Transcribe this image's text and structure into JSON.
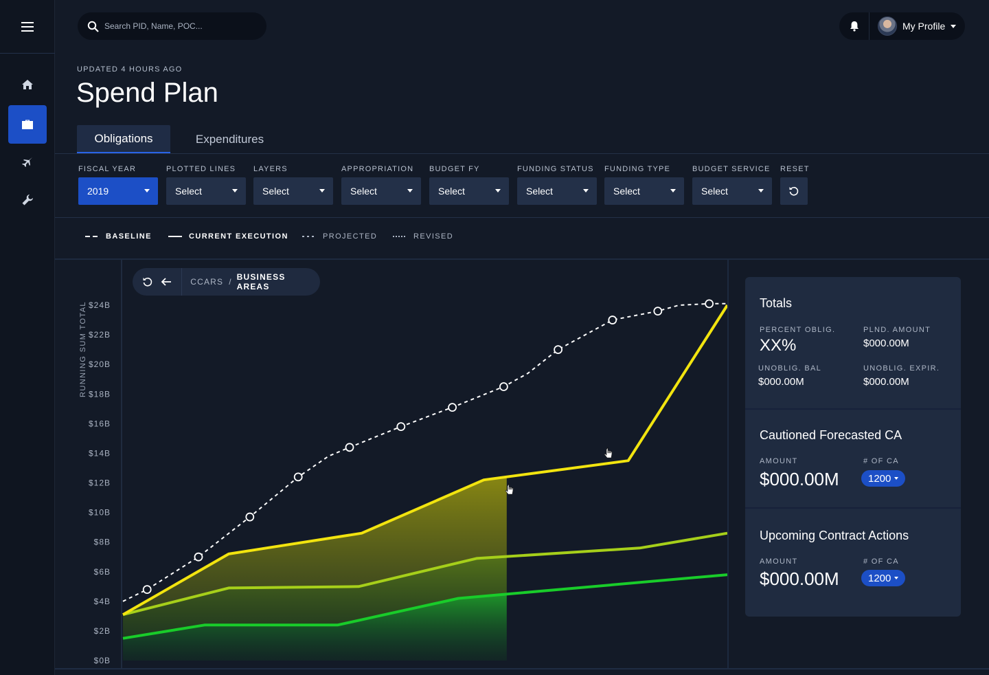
{
  "search": {
    "placeholder": "Search PID, Name, POC..."
  },
  "profile": {
    "name": "My Profile"
  },
  "header": {
    "updated": "UPDATED 4 HOURS AGO",
    "title": "Spend Plan"
  },
  "tabs": [
    {
      "label": "Obligations"
    },
    {
      "label": "Expenditures"
    }
  ],
  "filters": [
    {
      "label": "FISCAL YEAR",
      "value": "2019"
    },
    {
      "label": "PLOTTED LINES",
      "value": "Select"
    },
    {
      "label": "LAYERS",
      "value": "Select"
    },
    {
      "label": "APPROPRIATION",
      "value": "Select"
    },
    {
      "label": "BUDGET FY",
      "value": "Select"
    },
    {
      "label": "FUNDING STATUS",
      "value": "Select"
    },
    {
      "label": "FUNDING TYPE",
      "value": "Select"
    },
    {
      "label": "BUDGET SERVICE",
      "value": "Select"
    }
  ],
  "reset_label": "RESET",
  "legend": [
    {
      "label": "BASELINE"
    },
    {
      "label": "CURRENT EXECUTION"
    },
    {
      "label": "PROJECTED"
    },
    {
      "label": "REVISED"
    }
  ],
  "breadcrumb": {
    "parent": "CCARS",
    "sep": "/",
    "current": "BUSINESS AREAS"
  },
  "totals": {
    "title": "Totals",
    "percent_label": "PERCENT OBLIG.",
    "percent_value": "XX%",
    "plnd_label": "PLND. AMOUNT",
    "plnd_value": "$000.00M",
    "unoblig_label": "UNOBLIG. BAL",
    "unoblig_value": "$000.00M",
    "expir_label": "UNOBLIG. EXPIR.",
    "expir_value": "$000.00M"
  },
  "cautioned": {
    "title": "Cautioned Forecasted CA",
    "amount_label": "AMOUNT",
    "amount_value": "$000.00M",
    "count_label": "# OF CA",
    "count_value": "1200"
  },
  "upcoming": {
    "title": "Upcoming Contract Actions",
    "amount_label": "AMOUNT",
    "amount_value": "$000.00M",
    "count_label": "# OF CA",
    "count_value": "1200"
  },
  "colors": {
    "accent": "#1c4fc6",
    "execution": "#f2e40f",
    "mid_line": "#a6cf1a",
    "low_line": "#19cc2a",
    "background": "#131a27"
  },
  "chart_data": {
    "type": "line",
    "ylabel": "RUNNING SUM TOTAL",
    "ytick_labels": [
      "$24B",
      "$22B",
      "$20B",
      "$18B",
      "$16B",
      "$14B",
      "$12B",
      "$10B",
      "$8B",
      "$6B",
      "$4B",
      "$2B",
      "$0B"
    ],
    "ylim": [
      0,
      24
    ],
    "xlim": [
      0,
      1
    ],
    "grid": false,
    "series": [
      {
        "key": "projected",
        "style": "dashed-markers",
        "points": [
          [
            0,
            4
          ],
          [
            0.04,
            4.8
          ],
          [
            0.125,
            7
          ],
          [
            0.21,
            9.7
          ],
          [
            0.29,
            12.4
          ],
          [
            0.34,
            13.8
          ],
          [
            0.375,
            14.4
          ],
          [
            0.46,
            15.8
          ],
          [
            0.545,
            17.1
          ],
          [
            0.63,
            18.5
          ],
          [
            0.67,
            19.4
          ],
          [
            0.72,
            21
          ],
          [
            0.81,
            23
          ],
          [
            0.885,
            23.6
          ],
          [
            0.92,
            24
          ],
          [
            0.97,
            24.1
          ],
          [
            1,
            24.1
          ]
        ],
        "markers": [
          [
            0.04,
            4.8
          ],
          [
            0.125,
            7
          ],
          [
            0.21,
            9.7
          ],
          [
            0.29,
            12.4
          ],
          [
            0.375,
            14.4
          ],
          [
            0.46,
            15.8
          ],
          [
            0.545,
            17.1
          ],
          [
            0.63,
            18.5
          ],
          [
            0.72,
            21
          ],
          [
            0.81,
            23
          ],
          [
            0.885,
            23.6
          ],
          [
            0.97,
            24.1
          ]
        ]
      },
      {
        "key": "execution",
        "style": "solid",
        "points": [
          [
            0,
            3.1
          ],
          [
            0.175,
            7.2
          ],
          [
            0.395,
            8.6
          ],
          [
            0.597,
            12.2
          ],
          [
            0.67,
            12.6
          ],
          [
            0.836,
            13.5
          ],
          [
            1,
            24
          ]
        ]
      },
      {
        "key": "mid",
        "style": "solid",
        "points": [
          [
            0,
            3.1
          ],
          [
            0.175,
            4.9
          ],
          [
            0.39,
            5
          ],
          [
            0.585,
            6.9
          ],
          [
            0.855,
            7.6
          ],
          [
            1,
            8.6
          ]
        ]
      },
      {
        "key": "low",
        "style": "solid",
        "points": [
          [
            0,
            1.5
          ],
          [
            0.135,
            2.4
          ],
          [
            0.355,
            2.4
          ],
          [
            0.555,
            4.2
          ],
          [
            1,
            5.8
          ]
        ]
      }
    ],
    "shaded_until_x": 0.635
  }
}
